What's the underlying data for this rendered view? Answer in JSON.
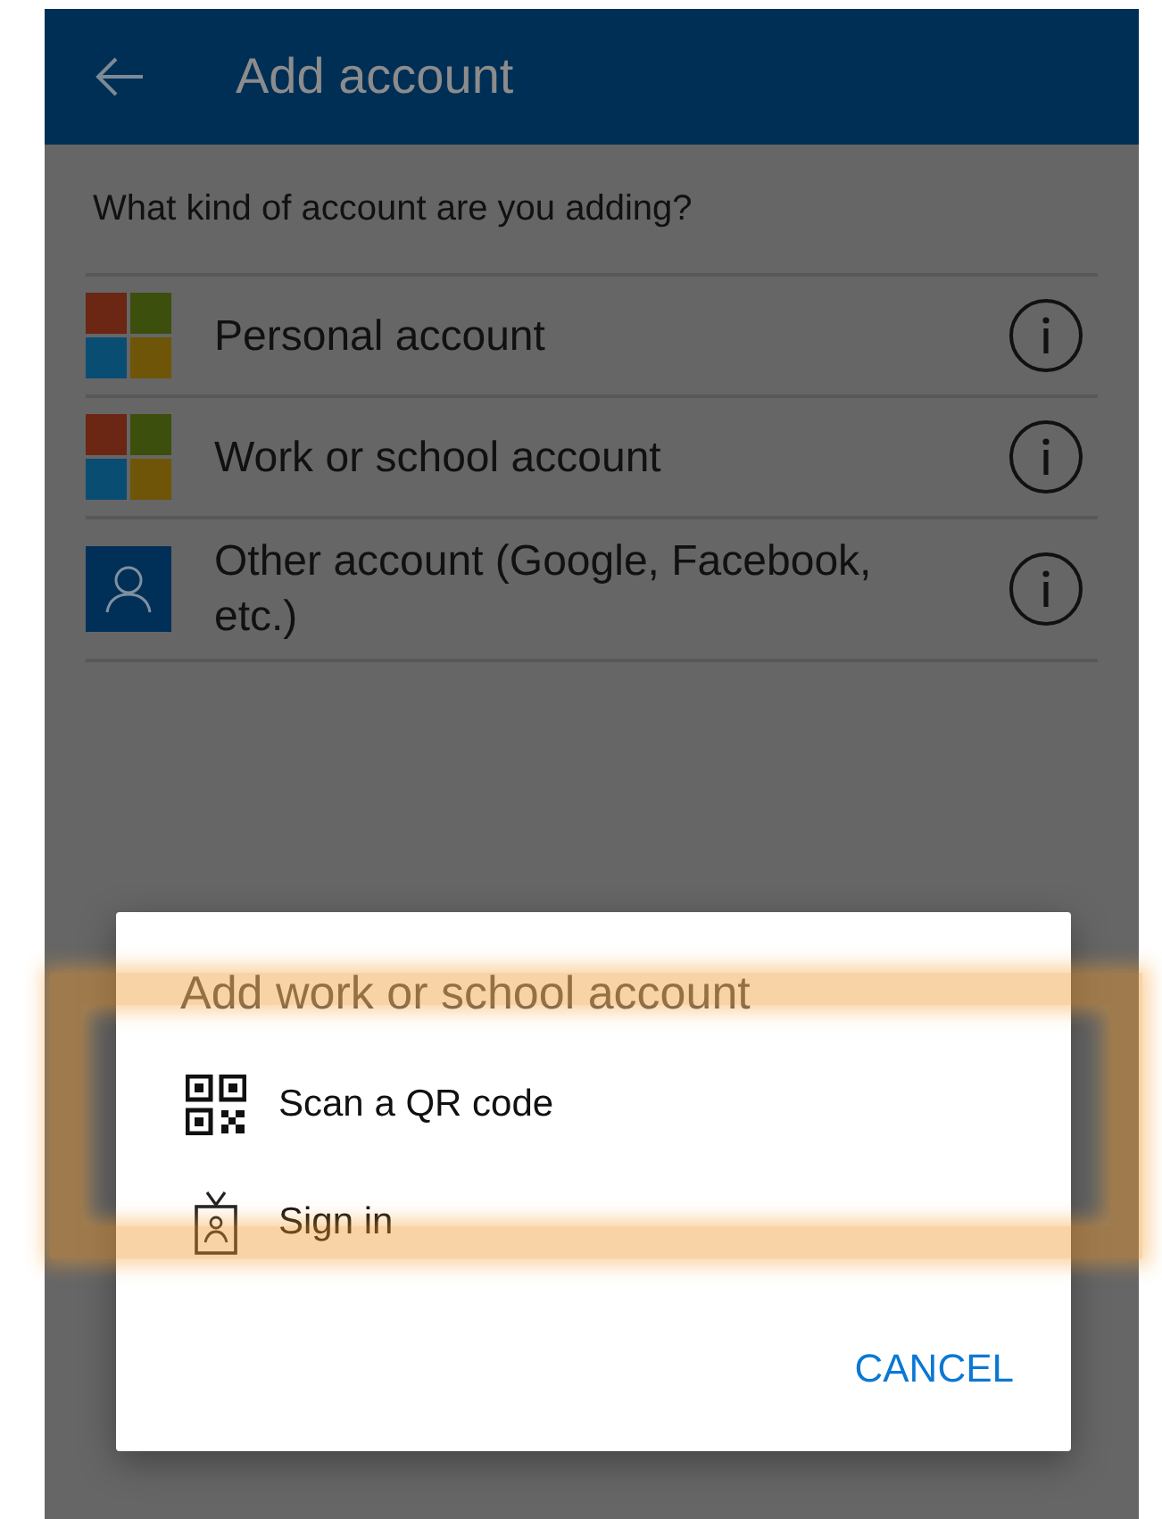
{
  "app_bar": {
    "title": "Add account"
  },
  "prompt": "What kind of account are you adding?",
  "account_types": [
    {
      "kind": "microsoft",
      "label": "Personal account"
    },
    {
      "kind": "microsoft",
      "label": "Work or school account"
    },
    {
      "kind": "person",
      "label": "Other account (Google, Facebook, etc.)"
    }
  ],
  "dialog": {
    "title": "Add work or school account",
    "options": [
      {
        "kind": "qr",
        "label": "Scan a QR code",
        "highlighted": true
      },
      {
        "kind": "badge",
        "label": "Sign in",
        "highlighted": false
      }
    ],
    "buttons": [
      "CANCEL"
    ]
  }
}
